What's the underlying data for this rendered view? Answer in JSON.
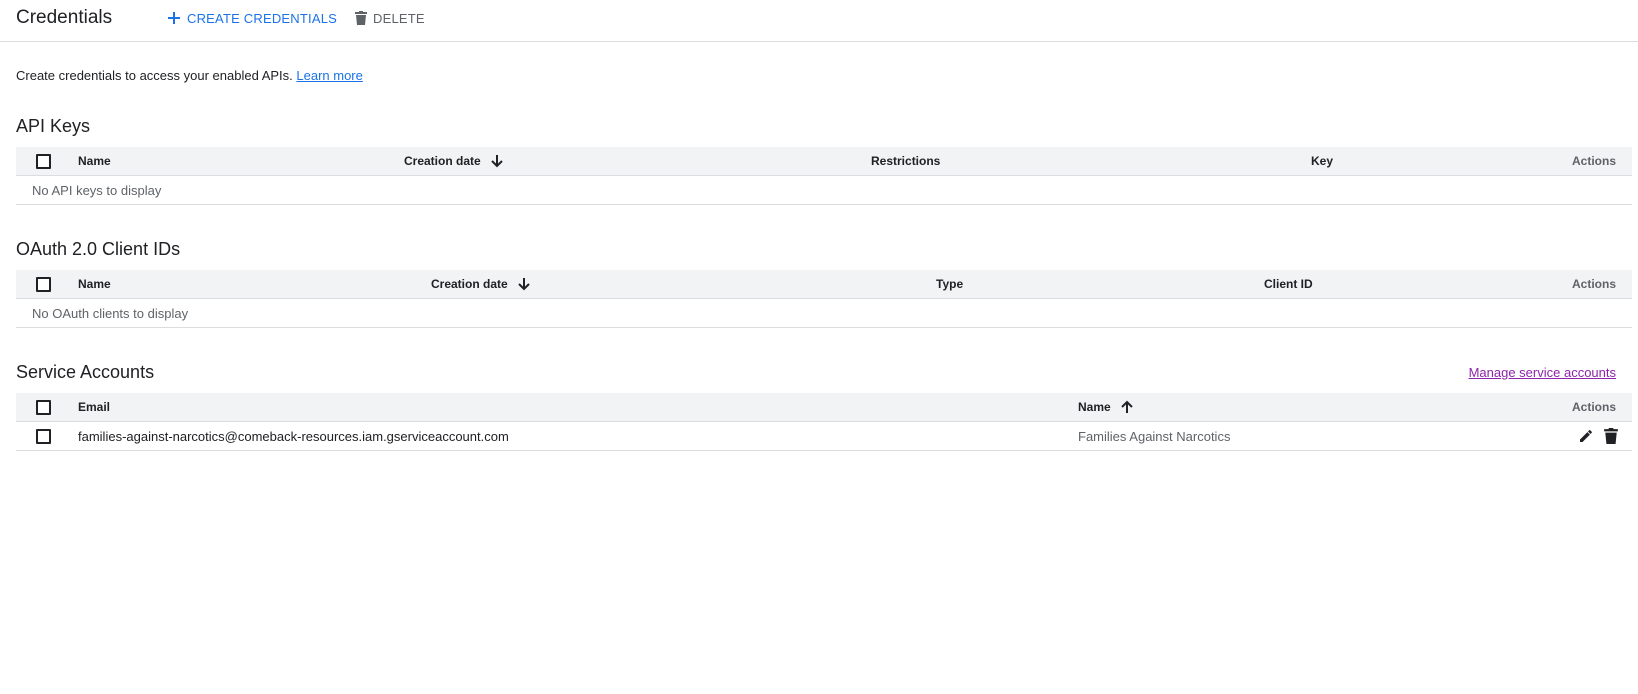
{
  "header": {
    "title": "Credentials",
    "create_label": "CREATE CREDENTIALS",
    "delete_label": "DELETE"
  },
  "intro": {
    "text": "Create credentials to access your enabled APIs.",
    "link": "Learn more"
  },
  "api_keys": {
    "title": "API Keys",
    "columns": [
      "Name",
      "Creation date",
      "Restrictions",
      "Key",
      "Actions"
    ],
    "empty": "No API keys to display"
  },
  "oauth": {
    "title": "OAuth 2.0 Client IDs",
    "columns": [
      "Name",
      "Creation date",
      "Type",
      "Client ID",
      "Actions"
    ],
    "empty": "No OAuth clients to display"
  },
  "service_accounts": {
    "title": "Service Accounts",
    "manage_link": "Manage service accounts",
    "columns": [
      "Email",
      "Name",
      "Actions"
    ],
    "rows": [
      {
        "email": "families-against-narcotics@comeback-resources.iam.gserviceaccount.com",
        "name": "Families Against Narcotics"
      }
    ]
  },
  "icons": {
    "create": "plus-icon",
    "delete": "trash-icon",
    "sort_desc": "arrow-down-icon",
    "sort_asc": "arrow-up-icon",
    "edit": "pencil-icon",
    "row_delete": "trash-icon"
  },
  "colors": {
    "accent": "#1a73e8",
    "link_visited": "#8e24aa",
    "header_bg": "#f1f3f4",
    "muted_text": "#5f6368",
    "divider": "#dadce0"
  }
}
